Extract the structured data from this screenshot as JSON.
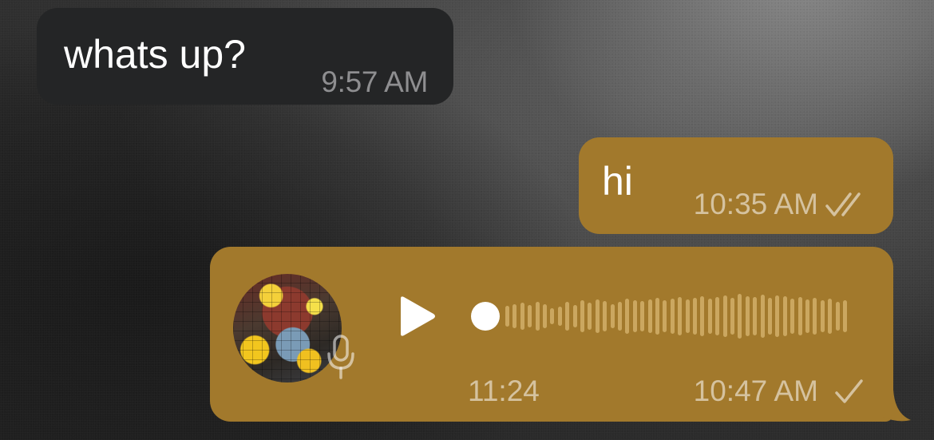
{
  "messages": {
    "incoming": {
      "text": "whats up?",
      "time": "9:57 AM"
    },
    "outgoing_text": {
      "text": "hi",
      "time": "10:35 AM",
      "status": "double-check-icon"
    },
    "outgoing_voice": {
      "duration": "11:24",
      "time": "10:47 AM",
      "status": "single-check-icon",
      "avatar_icon": "avatar-image",
      "mic_icon": "microphone-icon",
      "play_icon": "play-icon",
      "progress": 0.0
    }
  },
  "colors": {
    "incoming_bubble": "#242526",
    "outgoing_bubble": "#a2792c",
    "waveform": "#d8b772",
    "text_primary": "#ffffff",
    "timestamp_incoming": "#8e8e90"
  }
}
